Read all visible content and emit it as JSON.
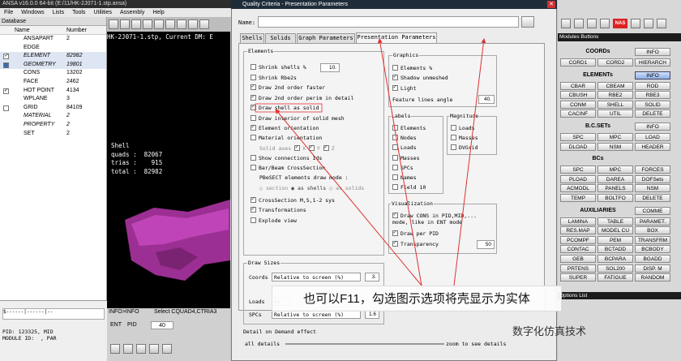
{
  "window": {
    "title": "ANSA v16.0.0 64-bit (E:/11/HK-2J071-1.stp.ansa)",
    "menu": [
      "File",
      "Windows",
      "Lists",
      "Tools",
      "Utilities",
      "Assembly",
      "Help"
    ]
  },
  "database": {
    "title": "Database",
    "col_name": "Name",
    "col_number": "Number",
    "rows": [
      {
        "name": "ANSAPART",
        "number": "2",
        "check": "none",
        "italic": false
      },
      {
        "name": "EDGE",
        "number": "",
        "check": "none",
        "italic": false
      },
      {
        "name": "ELEMENT",
        "number": "82982",
        "check": "on",
        "italic": true
      },
      {
        "name": "GEOMETRY",
        "number": "19801",
        "check": "part",
        "italic": true
      },
      {
        "name": "CONS",
        "number": "13202",
        "check": "none",
        "italic": false
      },
      {
        "name": "FACE",
        "number": "2462",
        "check": "none",
        "italic": false
      },
      {
        "name": "HOT POINT",
        "number": "4134",
        "check": "on",
        "italic": false
      },
      {
        "name": "WPLANE",
        "number": "3",
        "check": "none",
        "italic": false
      },
      {
        "name": "GRID",
        "number": "84109",
        "check": "off",
        "italic": false
      },
      {
        "name": "MATERIAL",
        "number": "2",
        "check": "none",
        "italic": true
      },
      {
        "name": "PROPERTY",
        "number": "2",
        "check": "none",
        "italic": true
      },
      {
        "name": "SET",
        "number": "2",
        "check": "none",
        "italic": false
      }
    ],
    "lower_text": "PID: 123325, MID\nMODULE ID:  , PAR",
    "lower_bar": "$------|------|--"
  },
  "graphics": {
    "file_label": "HK-2J071-1.stp,  Current DM: E",
    "stats": "Shell\nquads :  82067\ntrias :    915\ntotal :  82982"
  },
  "status": {
    "info": "INFO>INFO",
    "select": "Select CQUAD4,CTRIA3",
    "ent": "ENT",
    "pid": "PID",
    "zoom": "40"
  },
  "dialog": {
    "title": "Quality Criteria - Presentation Parameters",
    "name_label": "Name:",
    "tabs": [
      "Shells",
      "Solids",
      "Graph Parameters",
      "Presentation Parameters"
    ],
    "elements": {
      "title": "Elements",
      "shrink_shells": {
        "label": "Shrink shells %",
        "value": "10."
      },
      "items": [
        {
          "label": "Shrink Rbe2s",
          "checked": false
        },
        {
          "label": "Draw 2nd order faster",
          "checked": true
        },
        {
          "label": "Draw 2nd order perim in detail",
          "checked": true
        },
        {
          "label": "Draw shell as solid",
          "checked": true
        },
        {
          "label": "Draw interior of solid mesh",
          "checked": false
        },
        {
          "label": "Element orientation",
          "checked": true
        },
        {
          "label": "Material orientation",
          "checked": false
        }
      ],
      "solid_axes": {
        "label": "Solid axes",
        "x": "X",
        "y": "Y",
        "z": "Z"
      },
      "show_conn": {
        "label": "Show connections Ids",
        "checked": false
      },
      "bar_beam": {
        "label": "Bar/Beam CrossSection",
        "checked": false
      },
      "pbsect": "PBeSECT elements draw mode :",
      "modes": [
        "section",
        "as shells",
        "as solids"
      ],
      "items2": [
        {
          "label": "CrossSection M,S,1-2 sys",
          "checked": true
        },
        {
          "label": "Transformations",
          "checked": true
        },
        {
          "label": "Explode view",
          "checked": false
        }
      ]
    },
    "graphics_grp": {
      "title": "Graphics",
      "items": [
        {
          "label": "Elements %",
          "checked": false
        },
        {
          "label": "Shadow unmeshed",
          "checked": true
        },
        {
          "label": "Light",
          "checked": true
        }
      ],
      "feature_label": "Feature lines angle",
      "feature_value": "40."
    },
    "labels": {
      "title": "Labels",
      "items": [
        "Elements",
        "Nodes",
        "Loads",
        "Masses",
        "SPCs",
        "Names",
        "Field 10"
      ]
    },
    "magnitude": {
      "title": "Magnitude",
      "items": [
        "Loads",
        "Masses",
        "DVGrid"
      ]
    },
    "visualization": {
      "title": "Visualization",
      "cons_label": "Draw CONS in PID,MID,... mode, like in ENT mode",
      "items": [
        {
          "label": "Draw per PID",
          "checked": true
        },
        {
          "label": "Transparency",
          "checked": true
        }
      ],
      "transparency_value": "50"
    },
    "draw_sizes": {
      "title": "Draw Sizes",
      "coords_label": "Coords",
      "coords_mode": "Relative to screen (%)",
      "coords_value": "3.",
      "loads_label": "Loads",
      "loads_mode": "Re",
      "spcs_label": "SPCs",
      "spcs_mode": "Relative to screen (%)",
      "spcs_value": "1.6"
    },
    "detail": "Detail on Demand effect",
    "all_details": "all details",
    "zoom_details": "zoom to see details"
  },
  "buttons": {
    "title": "Modules Buttons",
    "options_title": "Options List",
    "sections": [
      {
        "head": "COORDs",
        "info": "INFO",
        "rows": [
          [
            "CORD1",
            "CORD2",
            "HIERARCH"
          ]
        ]
      },
      {
        "head": "ELEMENTs",
        "info": "INFO",
        "rows": [
          [
            "CBAR",
            "CBEAM",
            "ROD"
          ],
          [
            "CBUSH",
            "RBE2",
            "RBE3"
          ],
          [
            "CONM",
            "SHELL",
            "SOLID"
          ],
          [
            "CACINF",
            "UTIL",
            "DELETE"
          ]
        ]
      },
      {
        "head": "B.C.SETs",
        "info": "INFO",
        "rows": [
          [
            "SPC",
            "MPC",
            "LOAD"
          ],
          [
            "DLOAD",
            "NSM",
            "HEADER"
          ]
        ]
      },
      {
        "head": "BCs",
        "info": "",
        "rows": [
          [
            "SPC",
            "MPC",
            "FORCES"
          ],
          [
            "PLOAD",
            "DAREA",
            "DOFSets"
          ],
          [
            "ACMODL",
            "PANELS",
            "NSM"
          ],
          [
            "TEMP",
            "BOLTFO",
            "DELETE"
          ]
        ]
      },
      {
        "head": "AUXILIARIES",
        "info": "COMME",
        "rows": [
          [
            "LAMINA",
            "TABLE",
            "PARAMET."
          ],
          [
            "RES.MAP",
            "MODEL CU",
            "BOX"
          ],
          [
            "PCOMPF",
            "PEM",
            "TRANSFRM"
          ],
          [
            "CONTAC",
            "BCTADD",
            "BCBODY"
          ],
          [
            "GEB",
            "BCPARA",
            "BGADD"
          ],
          [
            "PRTENS",
            "SOL200",
            "DISP. M"
          ],
          [
            "SUPER",
            "FATIGUE",
            "RANDOM"
          ]
        ]
      }
    ]
  },
  "annotation": "也可以F11，勾选图示选项将壳显示为实体",
  "watermark": "数字化仿真技术",
  "colors": {
    "arrow": "#e03030",
    "blue_button": "#8fb0e8",
    "graphics_bg": "#000000",
    "mesh": "#b23aa6"
  }
}
